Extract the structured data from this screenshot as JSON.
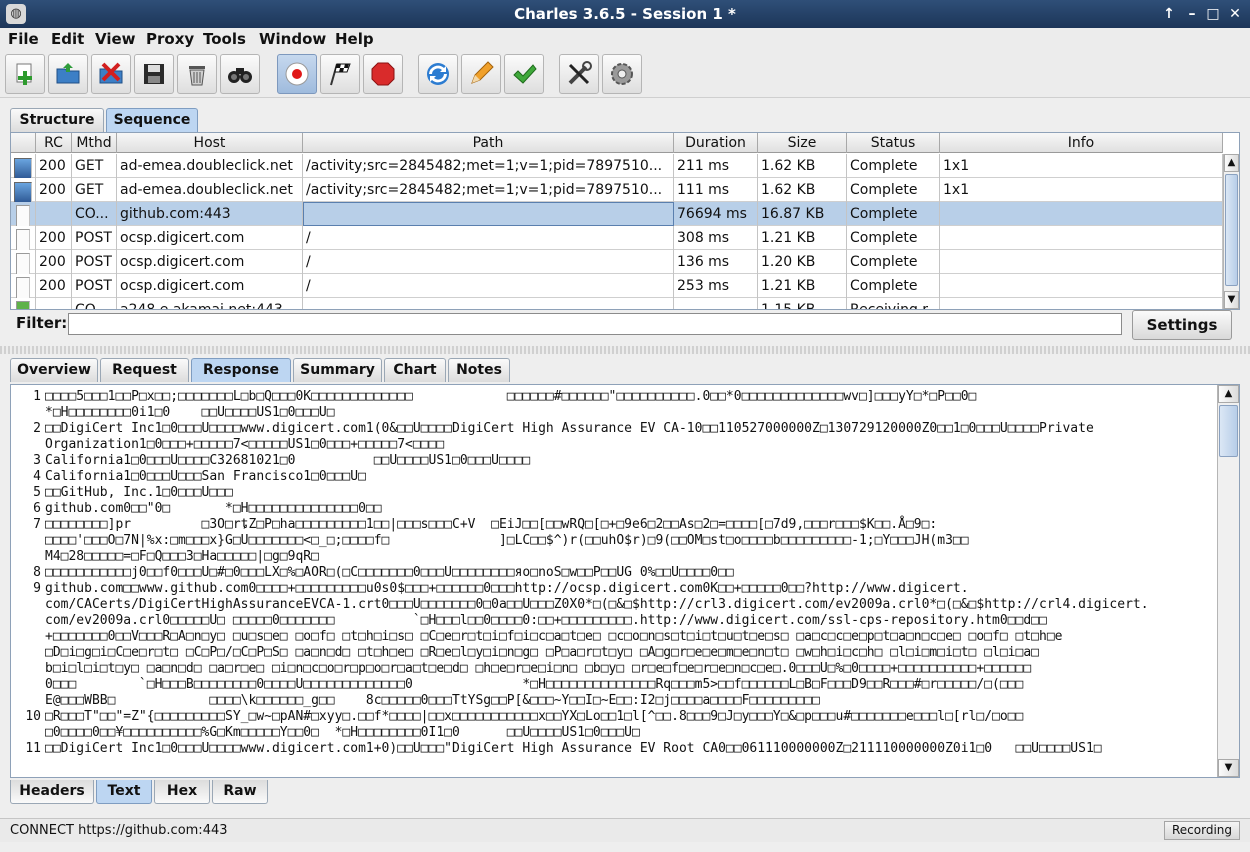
{
  "window": {
    "title": "Charles 3.6.5 - Session 1 *",
    "app_icon": "charles-jar-icon",
    "controls": [
      "↑",
      "–",
      "□",
      "✕"
    ]
  },
  "menu": {
    "items": [
      "File",
      "Edit",
      "View",
      "Proxy",
      "Tools",
      "Window",
      "Help"
    ]
  },
  "toolbar": {
    "icons": [
      "new-session-icon",
      "open-session-icon",
      "close-session-icon",
      "save-session-icon",
      "clear-session-icon",
      "find-icon",
      "record-icon",
      "throttle-icon",
      "breakpoints-icon",
      "repeat-icon",
      "edit-icon",
      "validate-icon",
      "tools-icon",
      "settings-gear-icon"
    ]
  },
  "view_tabs": [
    "Structure",
    "Sequence"
  ],
  "active_view_tab": "Sequence",
  "table": {
    "columns": [
      "",
      "RC",
      "Mthd",
      "Host",
      "Path",
      "Duration",
      "Size",
      "Status",
      "Info"
    ],
    "rows": [
      {
        "icon": "image-request-icon",
        "rc": "200",
        "method": "GET",
        "host": "ad-emea.doubleclick.net",
        "path": "/activity;src=2845482;met=1;v=1;pid=7897510...",
        "duration": "211 ms",
        "size": "1.62 KB",
        "status": "Complete",
        "info": "1x1"
      },
      {
        "icon": "image-request-icon",
        "rc": "200",
        "method": "GET",
        "host": "ad-emea.doubleclick.net",
        "path": "/activity;src=2845482;met=1;v=1;pid=7897510...",
        "duration": "111 ms",
        "size": "1.62 KB",
        "status": "Complete",
        "info": "1x1"
      },
      {
        "icon": "document-request-icon",
        "rc": "",
        "method": "CO...",
        "host": "github.com:443",
        "path": "",
        "duration": "76694 ms",
        "size": "16.87 KB",
        "status": "Complete",
        "info": "",
        "selected": true
      },
      {
        "icon": "document-request-icon",
        "rc": "200",
        "method": "POST",
        "host": "ocsp.digicert.com",
        "path": "/",
        "duration": "308 ms",
        "size": "1.21 KB",
        "status": "Complete",
        "info": ""
      },
      {
        "icon": "document-request-icon",
        "rc": "200",
        "method": "POST",
        "host": "ocsp.digicert.com",
        "path": "/",
        "duration": "136 ms",
        "size": "1.20 KB",
        "status": "Complete",
        "info": ""
      },
      {
        "icon": "document-request-icon",
        "rc": "200",
        "method": "POST",
        "host": "ocsp.digicert.com",
        "path": "/",
        "duration": "253 ms",
        "size": "1.21 KB",
        "status": "Complete",
        "info": ""
      },
      {
        "icon": "in-progress-request-icon",
        "rc": "",
        "method": "CO...",
        "host": "a248.e.akamai.net:443",
        "path": "",
        "duration": "",
        "size": "1.15 KB",
        "status": "Receiving r...",
        "info": ""
      }
    ]
  },
  "filter": {
    "label": "Filter:",
    "value": ""
  },
  "settings_button": "Settings",
  "detail_tabs": [
    "Overview",
    "Request",
    "Response",
    "Summary",
    "Chart",
    "Notes"
  ],
  "active_detail_tab": "Response",
  "response": {
    "lines": [
      {
        "n": "1",
        "text": "□□□□5□□□1□□P□x□□;□□□□□□□L□b□Q□□□0K□□□□□□□□□□□□□            □□□□□□#□□□□□□\"□□□□□□□□□□.0□□*0□□□□□□□□□□□□□wv□]□□□yY□*□P□□0□\n*□H□□□□□□□□0i1□0    □□U□□□□US1□0□□□U□"
      },
      {
        "n": "2",
        "text": "□□DigiCert Inc1□0□□□U□□□□www.digicert.com1(0&□□U□□□□DigiCert High Assurance EV CA-10□□110527000000Z□130729120000Z0□□1□0□□□U□□□□Private\nOrganization1□0□□□+□□□□□7<□□□□□US1□0□□□+□□□□□7<□□□□"
      },
      {
        "n": "3",
        "text": "California1□0□□□U□□□□C32681021□0          □□U□□□□US1□0□□□U□□□□"
      },
      {
        "n": "4",
        "text": "California1□0□□□U□□□San Francisco1□0□□□U□"
      },
      {
        "n": "5",
        "text": "□□GitHub, Inc.1□0□□□U□□□"
      },
      {
        "n": "6",
        "text": "github.com0□□\"0□       *□H□□□□□□□□□□□□□□0□□"
      },
      {
        "n": "7",
        "text": "□□□□□□□□]pr         □3O□rȶZ□P□ha□□□□□□□□□1□□|□□□s□□□C+V  □EiJ□□[□□wRQ□[□+□9e6□2□□As□2□=□□□□[□7d9,□□□r□□□$K□□.Å□9□:\n□□□□'□□□O□7N|%x:□m□□□x}G□U□□□□□□□<□_□;□□□□f□              ]□LC□□$^)r(□□uhO$r)□9(□□OM□st□o□□□□b□□□□□□□□□-1;□Y□□□JH(m3□□\nM4□28□□□□□=□F□Q□□□3□Ha□□□□□|□g□9qR□"
      },
      {
        "n": "8",
        "text": "□□□□□□□□□□□j0□□f0□□□U□#□0□□□LX□%□AOR□(□C□□□□□□□0□□□U□□□□□□□□яо□noS□w□□P□□UG 0%□□U□□□□0□□"
      },
      {
        "n": "9",
        "text": "github.com□□www.github.com0□□□□+□□□□□□□□□u0s0$□□□+□□□□□□0□□□http://ocsp.digicert.com0K□□+□□□□□0□□?http://www.digicert.\ncom/CACerts/DigiCertHighAssuranceEVCA-1.crt0□□□U□□□□□□□0□0a□□U□□□Z0X0*□(□&□$http://crl3.digicert.com/ev2009a.crl0*□(□&□$http://crl4.digicert.\ncom/ev2009a.crl0□□□□□U□ □□□□□0□□□□□□□          `□H□□□l□□0□□□□0:□□+□□□□□□□□□.http://www.digicert.com/ssl-cps-repository.htm0□□d□□\n+□□□□□□□0□□V□□□R□A□n□y□ □u□s□e□ □o□f□ □t□h□i□s□ □C□e□r□t□i□f□i□c□a□t□e□ □c□o□n□s□t□i□t□u□t□e□s□ □a□c□c□e□p□t□a□n□c□e□ □o□f□ □t□h□e\n□D□i□g□i□C□e□r□t□ □C□P□/□C□P□S□ □a□n□d□ □t□h□e□ □R□e□l□y□i□n□g□ □P□a□r□t□y□ □A□g□r□e□e□m□e□n□t□ □w□h□i□c□h□ □l□i□m□i□t□ □l□i□a□\nb□i□l□i□t□y□ □a□n□d□ □a□r□e□ □i□n□c□o□r□p□o□r□a□t□e□d□ □h□e□r□e□i□n□ □b□y□ □r□e□f□e□r□e□n□c□e□.0□□□U□%□0□□□□+□□□□□□□□□□+□□□□□□\n0□□□        `□H□□□B□□□□□□□□0□□□□U□□□□□□□□□□□□□0              *□H□□□□□□□□□□□□□□Rq□□□m5>□□f□□□□□□L□B□F□□□D9□□R□□□#□r□□□□□/□(□□□\nE@□□□WBB□            □□□□\\k□□□□□□_g□□    8c□□□□□0□□□TtYSg□□P[&□□□~Y□□I□~E□□:I2□j□□□□a□□□□F□□□□□□□□□"
      },
      {
        "n": "10",
        "text": "□R□□□T\"□□\"=Z\"{□□□□□□□□□SY_□w~□pAN#□xyy□.□□f*□□□□|□□x□□□□□□□□□□□x□□YX□Lo□□1□l[^□□.8□□□9□J□y□□□Y□&□p□□□u#□□□□□□□e□□□l□[rl□/□o□□\n□0□□□□0□□¥□□□□□□□□□□%G□Km□□□□□Y□□0□  *□H□□□□□□□□0I1□0      □□U□□□□US1□0□□□U□"
      },
      {
        "n": "11",
        "text": "□□DigiCert Inc1□0□□□U□□□□www.digicert.com1+0)□□U□□□\"DigiCert High Assurance EV Root CA0□□061110000000Z□211110000000Z0i1□0   □□U□□□□US1□"
      }
    ]
  },
  "format_tabs": [
    "Headers",
    "Text",
    "Hex",
    "Raw"
  ],
  "active_format_tab": "Text",
  "status": {
    "text": "CONNECT https://github.com:443",
    "recording": "Recording"
  }
}
